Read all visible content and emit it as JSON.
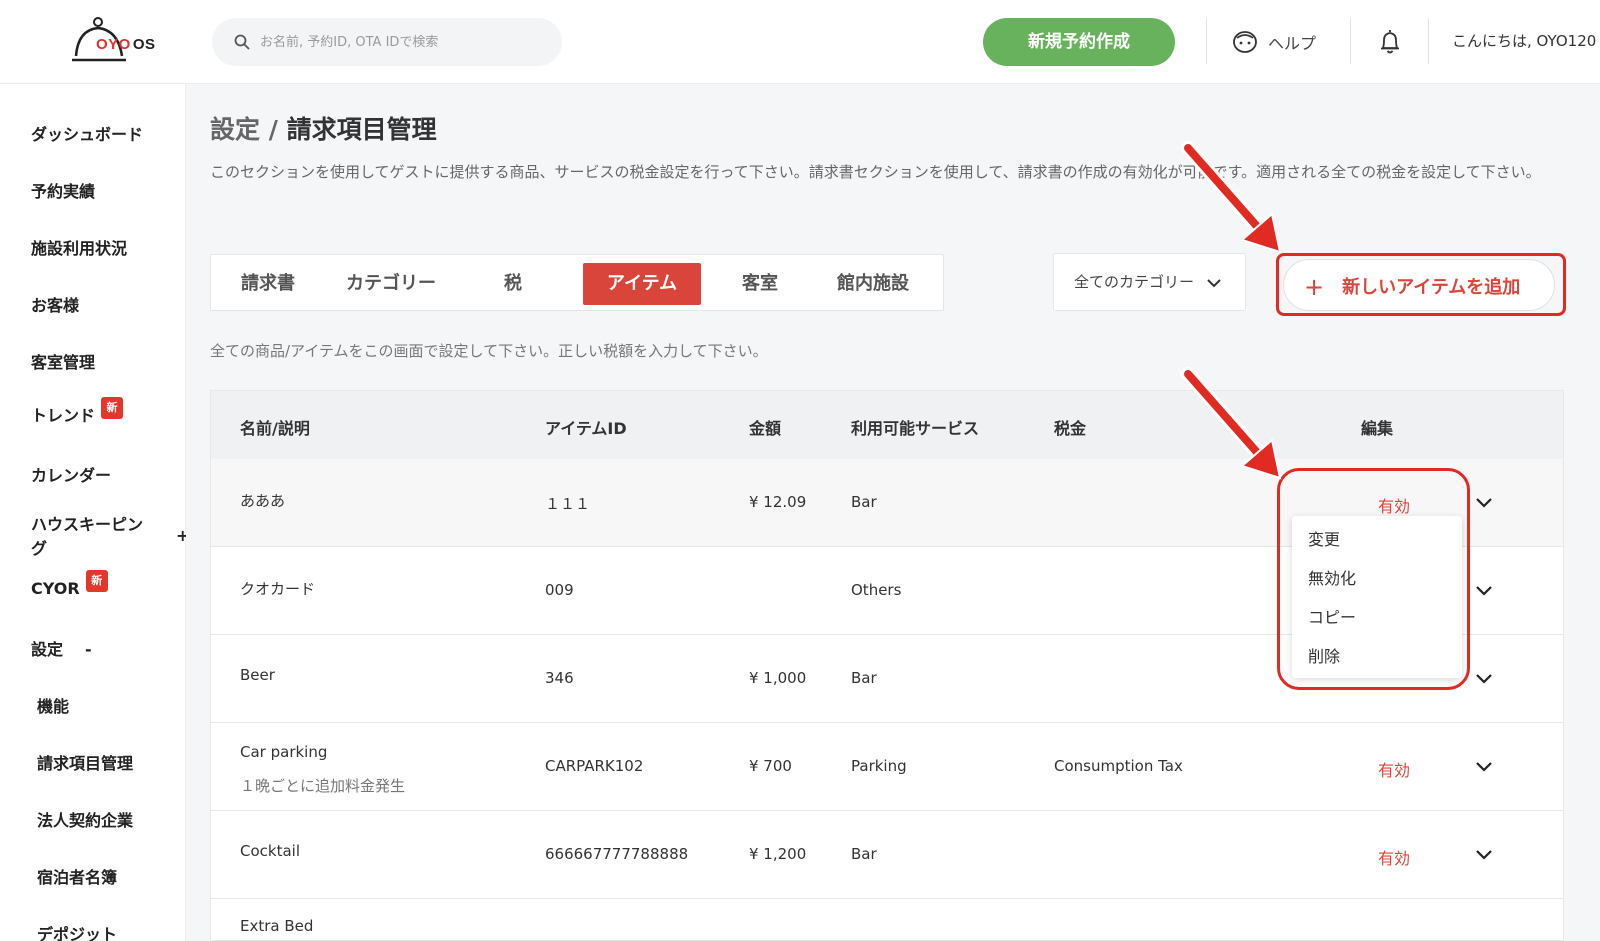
{
  "header": {
    "logo_brand": "OYO",
    "logo_suffix": "OS",
    "search_placeholder": "お名前, 予約ID, OTA IDで検索",
    "new_reservation": "新規予約作成",
    "help": "ヘルプ",
    "greeting": "こんにちは, OYO120"
  },
  "sidebar": {
    "items": [
      {
        "label": "ダッシュボード"
      },
      {
        "label": "予約実績"
      },
      {
        "label": "施設利用状況"
      },
      {
        "label": "お客様"
      },
      {
        "label": "客室管理"
      },
      {
        "label": "トレンド",
        "badge": "新"
      },
      {
        "label": "カレンダー"
      },
      {
        "label": "ハウスキーピン"
      },
      {
        "label": "グ"
      },
      {
        "label": "CYOR",
        "badge": "新"
      },
      {
        "label": "設定"
      },
      {
        "label": "機能"
      },
      {
        "label": "請求項目管理"
      },
      {
        "label": "法人契約企業"
      },
      {
        "label": "宿泊者名簿"
      },
      {
        "label": "デポジット"
      }
    ],
    "housekeeping_toggle": "+",
    "settings_toggle": "-"
  },
  "page": {
    "breadcrumb_parent": "設定",
    "separator": " / ",
    "title": "請求項目管理",
    "description": "このセクションを使用してゲストに提供する商品、サービスの税金設定を行って下さい。請求書セクションを使用して、請求書の作成の有効化が可能です。適用される全ての税金を設定して下さい。",
    "tabs": [
      "請求書",
      "カテゴリー",
      "税",
      "アイテム",
      "客室",
      "館内施設"
    ],
    "active_tab": "アイテム",
    "category_filter": "全てのカテゴリー",
    "add_item": "新しいアイテムを追加",
    "add_icon": "+",
    "sub_description": "全ての商品/アイテムをこの画面で設定して下さい。正しい税額を入力して下さい。"
  },
  "table": {
    "headers": {
      "name": "名前/説明",
      "item_id": "アイテムID",
      "amount": "金額",
      "service": "利用可能サービス",
      "tax": "税金",
      "edit": "編集"
    },
    "rows": [
      {
        "name": "あああ",
        "sub": "",
        "id": "１１１",
        "amount": "¥ 12.09",
        "service": "Bar",
        "tax": "",
        "status": "有効"
      },
      {
        "name": "クオカード",
        "sub": "",
        "id": "009",
        "amount": "",
        "service": "Others",
        "tax": "",
        "status": ""
      },
      {
        "name": "Beer",
        "sub": "",
        "id": "346",
        "amount": "¥ 1,000",
        "service": "Bar",
        "tax": "",
        "status": ""
      },
      {
        "name": "Car parking",
        "sub": "１晩ごとに追加料金発生",
        "id": "CARPARK102",
        "amount": "¥ 700",
        "service": "Parking",
        "tax": "Consumption Tax",
        "status": "有効"
      },
      {
        "name": "Cocktail",
        "sub": "",
        "id": "666667777788888",
        "amount": "¥ 1,200",
        "service": "Bar",
        "tax": "",
        "status": "有効"
      },
      {
        "name": "Extra Bed",
        "sub": "",
        "id": "",
        "amount": "",
        "service": "",
        "tax": "",
        "status": ""
      }
    ]
  },
  "dropdown": {
    "items": [
      "変更",
      "無効化",
      "コピー",
      "削除"
    ]
  },
  "colors": {
    "accent": "#d9453a",
    "primary_green": "#68b25e",
    "annotation_red": "#e02a22"
  }
}
